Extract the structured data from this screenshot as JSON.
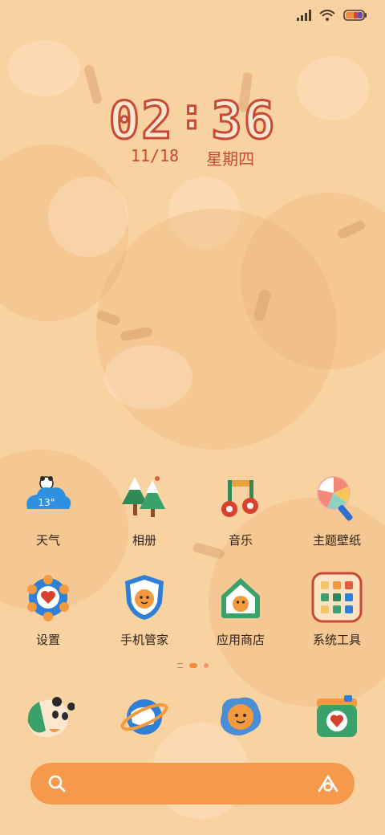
{
  "status": {
    "signal_icon": "signal-icon",
    "wifi_icon": "wifi-icon",
    "battery_icon": "battery-icon"
  },
  "clock": {
    "hour": "02",
    "minute": "36",
    "separator": ":",
    "date": "11/18",
    "weekday": "星期四"
  },
  "weather_badge": "13°",
  "apps_row1": [
    {
      "label": "天气",
      "icon": "weather-icon"
    },
    {
      "label": "相册",
      "icon": "gallery-icon"
    },
    {
      "label": "音乐",
      "icon": "music-icon"
    },
    {
      "label": "主题壁纸",
      "icon": "themes-icon"
    }
  ],
  "apps_row2": [
    {
      "label": "设置",
      "icon": "settings-icon"
    },
    {
      "label": "手机管家",
      "icon": "security-icon"
    },
    {
      "label": "应用商店",
      "icon": "app-store-icon"
    },
    {
      "label": "系统工具",
      "icon": "folder-icon"
    }
  ],
  "dock": [
    {
      "icon": "phone-icon"
    },
    {
      "icon": "browser-icon"
    },
    {
      "icon": "messages-icon"
    },
    {
      "icon": "camera-icon"
    }
  ],
  "search": {
    "placeholder": ""
  },
  "colors": {
    "background": "#f9d2a1",
    "accent": "#f59a4c",
    "clock": "#c84a34"
  }
}
